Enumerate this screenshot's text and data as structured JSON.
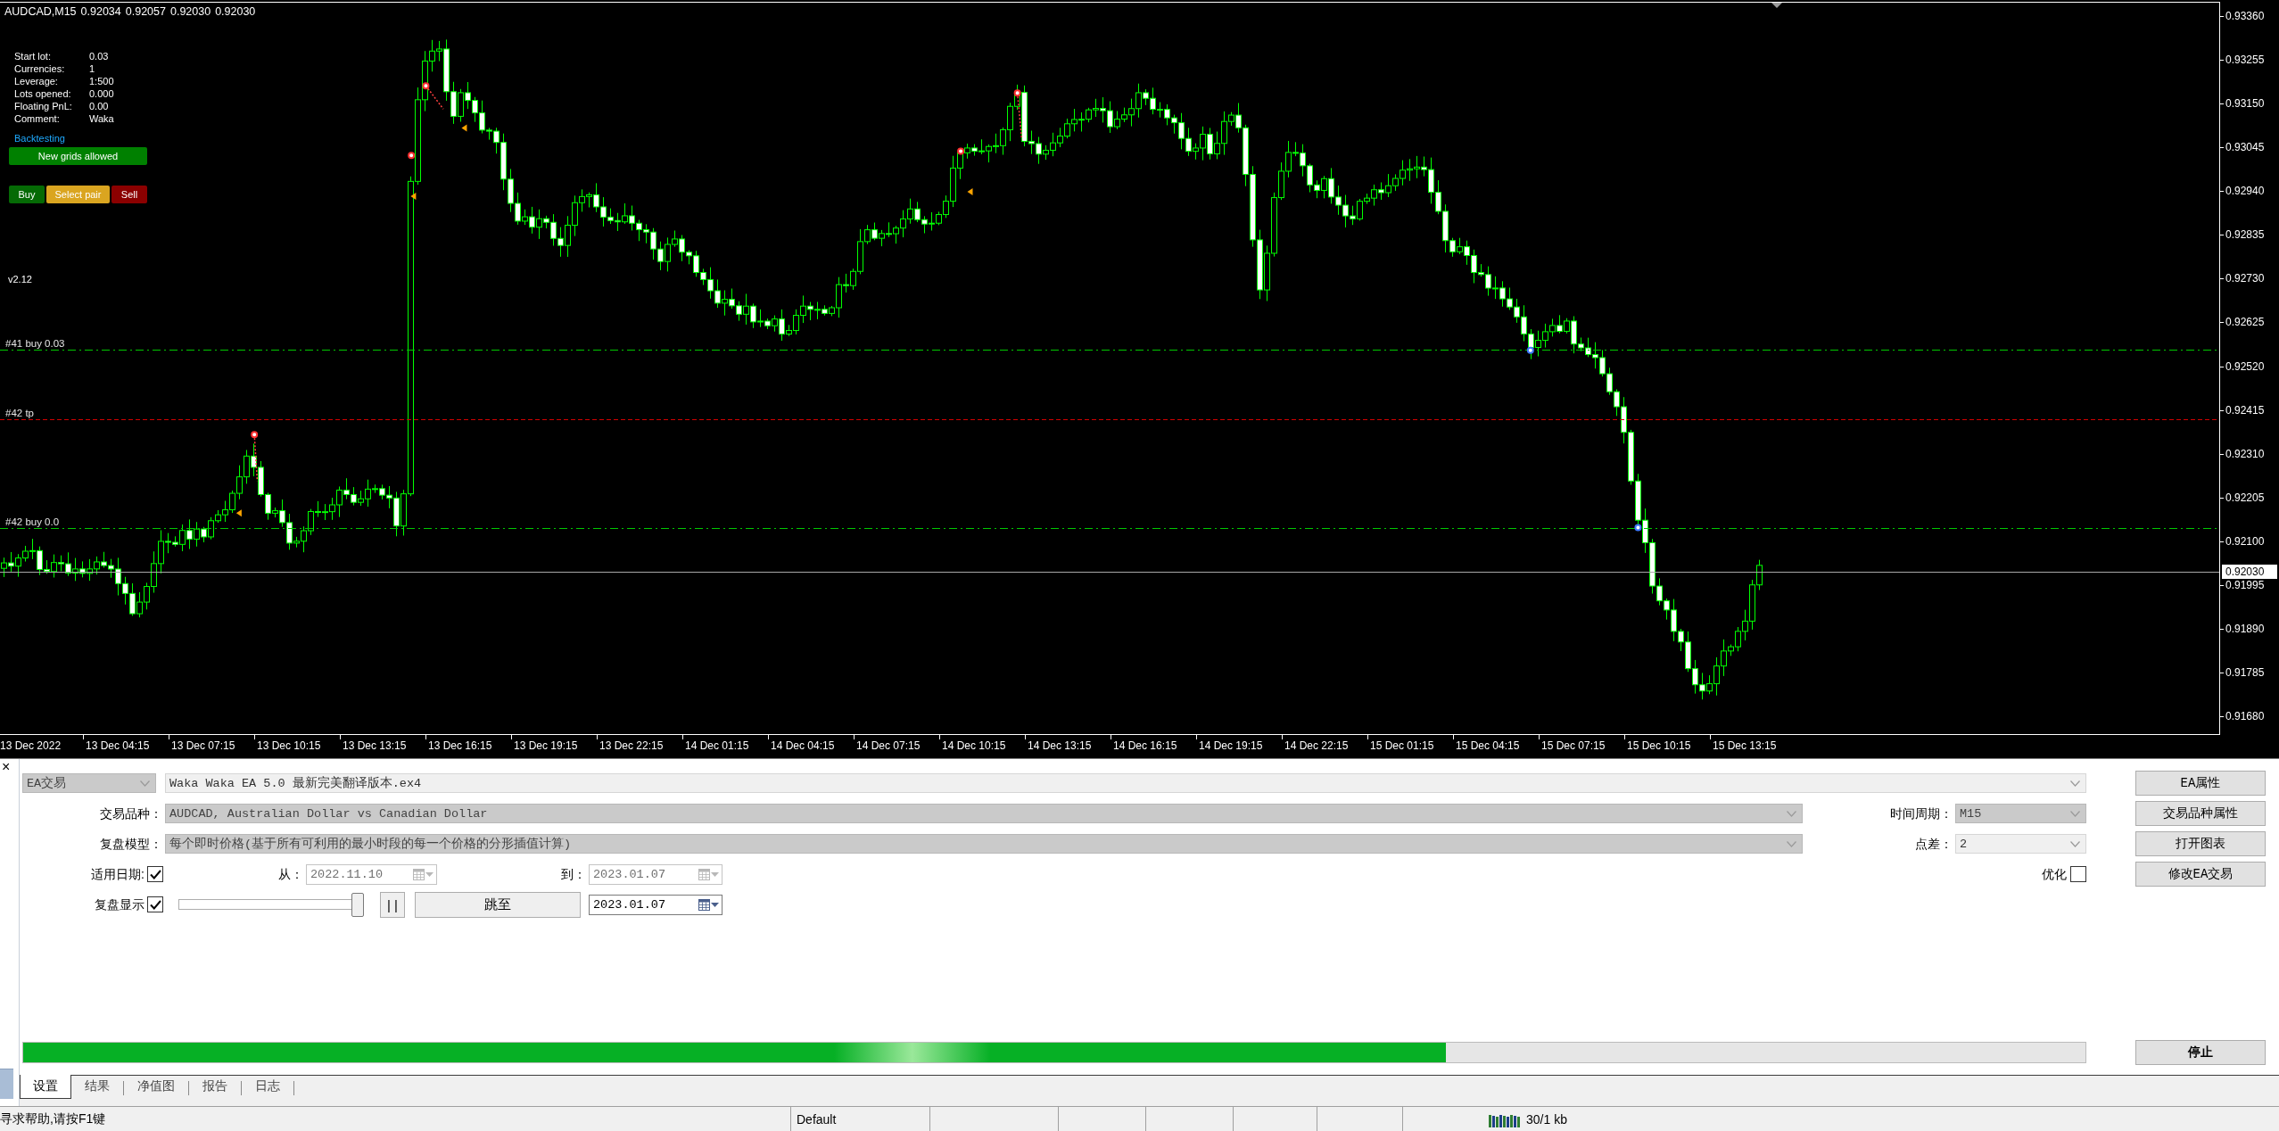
{
  "chart": {
    "symbol": "AUDCAD,M15",
    "prices": [
      "0.92034",
      "0.92057",
      "0.92030",
      "0.92030"
    ],
    "info": [
      {
        "label": "Start lot:",
        "value": "0.03"
      },
      {
        "label": "Currencies:",
        "value": "1"
      },
      {
        "label": "Leverage:",
        "value": "1:500"
      },
      {
        "label": "Lots opened:",
        "value": "0.000"
      },
      {
        "label": "Floating PnL:",
        "value": "0.00"
      },
      {
        "label": "Comment:",
        "value": "Waka"
      }
    ],
    "mode": "Backtesting",
    "grid_status": "New grids allowed",
    "buttons": [
      {
        "label": "Buy",
        "kind": "buy"
      },
      {
        "label": "Select pair",
        "kind": "select"
      },
      {
        "label": "Sell",
        "kind": "sell"
      }
    ],
    "version": "v2.12",
    "order_lines": [
      {
        "label": "#41 buy 0.03",
        "kind": "order"
      },
      {
        "label": "#42 tp",
        "kind": "take_profit"
      },
      {
        "label": "#42 buy 0.0",
        "kind": "order"
      }
    ],
    "price_axis": [
      "0.93360",
      "0.93255",
      "0.93150",
      "0.93045",
      "0.92940",
      "0.92835",
      "0.92730",
      "0.92625",
      "0.92520",
      "0.92415",
      "0.92310",
      "0.92205",
      "0.92100",
      "0.91995",
      "0.91890",
      "0.91785",
      "0.91680"
    ],
    "bid": "0.92030",
    "time_axis": [
      "13 Dec 2022",
      "13 Dec 04:15",
      "13 Dec 07:15",
      "13 Dec 10:15",
      "13 Dec 13:15",
      "13 Dec 16:15",
      "13 Dec 19:15",
      "13 Dec 22:15",
      "14 Dec 01:15",
      "14 Dec 04:15",
      "14 Dec 07:15",
      "14 Dec 10:15",
      "14 Dec 13:15",
      "14 Dec 16:15",
      "14 Dec 19:15",
      "14 Dec 22:15",
      "15 Dec 01:15",
      "15 Dec 04:15",
      "15 Dec 07:15",
      "15 Dec 10:15",
      "15 Dec 13:15"
    ]
  },
  "tester": {
    "close": "×",
    "expert_type": {
      "value": "EA交易",
      "disabled": true
    },
    "expert": {
      "value": "Waka Waka EA 5.0 最新完美翻译版本.ex4",
      "disabled": false
    },
    "symbol": {
      "label": "交易品种：",
      "value": "AUDCAD, Australian Dollar vs Canadian Dollar",
      "disabled": true
    },
    "period": {
      "label": "时间周期：",
      "value": "M15",
      "disabled": true
    },
    "model": {
      "label": "复盘模型：",
      "value": "每个即时价格(基于所有可利用的最小时段的每一个价格的分形插值计算)",
      "disabled": true
    },
    "spread": {
      "label": "点差：",
      "value": "2",
      "disabled": false
    },
    "use_date": {
      "label": "适用日期:",
      "checked": true
    },
    "from": {
      "label": "从：",
      "value": "2022.11.10",
      "disabled": true
    },
    "to": {
      "label": "到：",
      "value": "2023.01.07",
      "disabled": true
    },
    "optimization": {
      "label": "优化",
      "checked": false
    },
    "visual_mode": {
      "label": "复盘显示",
      "checked": true
    },
    "speed": {
      "level": 1
    },
    "pause_button": "| |",
    "skip_button": "跳至",
    "skip_date": {
      "value": "2023.01.07",
      "disabled": false
    },
    "side_buttons": [
      "EA属性",
      "交易品种属性",
      "打开图表",
      "修改EA交易"
    ],
    "progress": {
      "level": 0.69
    },
    "stop_button": "停止",
    "tabs": [
      {
        "label": "设置",
        "selected": true
      },
      {
        "label": "结果",
        "selected": false
      },
      {
        "label": "净值图",
        "selected": false
      },
      {
        "label": "报告",
        "selected": false
      },
      {
        "label": "日志",
        "selected": false
      }
    ]
  },
  "status_bar": {
    "help": "寻求帮助,请按F1键",
    "profile": "Default",
    "traffic": "30/1 kb"
  }
}
